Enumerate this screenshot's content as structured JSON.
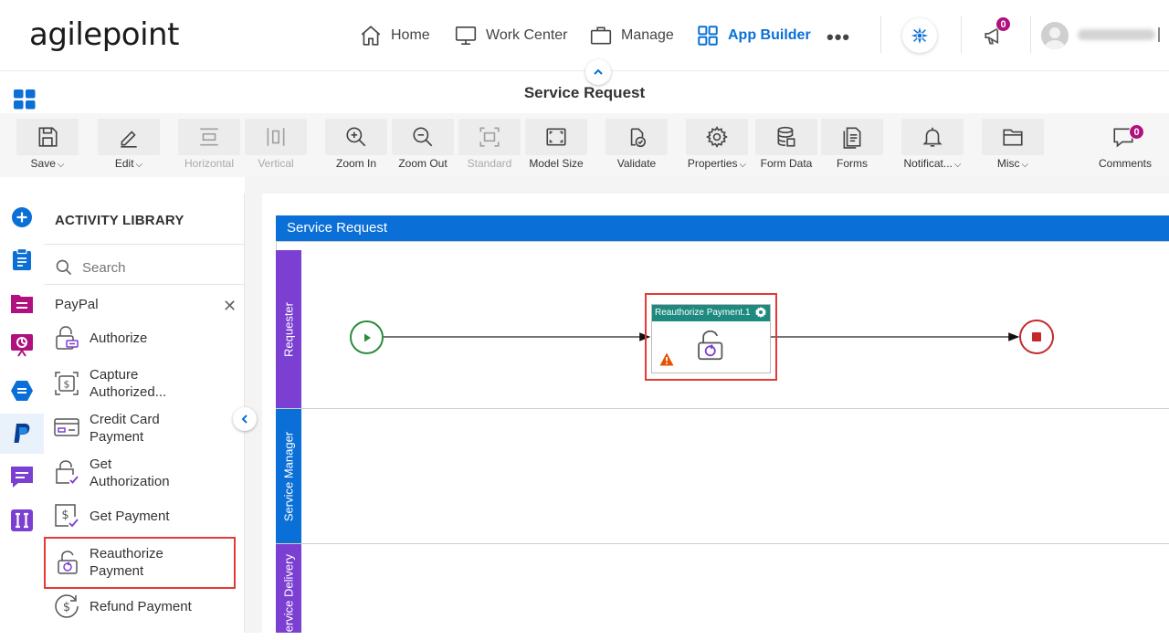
{
  "brand": {
    "logo_text": "agilepoint"
  },
  "nav": {
    "items": [
      {
        "label": "Home",
        "icon": "home-icon"
      },
      {
        "label": "Work Center",
        "icon": "monitor-icon"
      },
      {
        "label": "Manage",
        "icon": "briefcase-icon"
      },
      {
        "label": "App Builder",
        "icon": "grid-icon",
        "active": true
      }
    ],
    "more": "•••",
    "notifications_count": "0"
  },
  "page": {
    "title": "Service Request"
  },
  "toolbar": {
    "save": "Save",
    "edit": "Edit",
    "horizontal": "Horizontal",
    "vertical": "Vertical",
    "zoom_in": "Zoom In",
    "zoom_out": "Zoom Out",
    "standard": "Standard",
    "model_size": "Model Size",
    "validate": "Validate",
    "properties": "Properties",
    "form_data": "Form Data",
    "forms": "Forms",
    "notifications": "Notificat...",
    "misc": "Misc",
    "comments": "Comments",
    "comments_count": "0",
    "caret": "⌵"
  },
  "library": {
    "title": "ACTIVITY LIBRARY",
    "search_placeholder": "Search",
    "category": "PayPal",
    "close": "✕",
    "activities": [
      {
        "line1": "Authorize",
        "line2": ""
      },
      {
        "line1": "Capture",
        "line2": "Authorized..."
      },
      {
        "line1": "Credit Card",
        "line2": "Payment"
      },
      {
        "line1": "Get",
        "line2": "Authorization"
      },
      {
        "line1": "Get Payment",
        "line2": ""
      },
      {
        "line1": "Reauthorize",
        "line2": "Payment"
      },
      {
        "line1": "Refund Payment",
        "line2": ""
      }
    ]
  },
  "process": {
    "pool_name": "Service Request",
    "lanes": [
      "Requester",
      "Service Manager",
      "Service Delivery"
    ],
    "lane_colors": [
      "#7b3fd1",
      "#0a6fd6",
      "#7b3fd1"
    ],
    "task_label": "Reauthorize Payment.1"
  },
  "colors": {
    "accent": "#0a6fd6",
    "selection": "#e53935",
    "task_header": "#1e8a7f",
    "start": "#2e8b3e",
    "end": "#c62828",
    "badge": "#b0117f"
  }
}
